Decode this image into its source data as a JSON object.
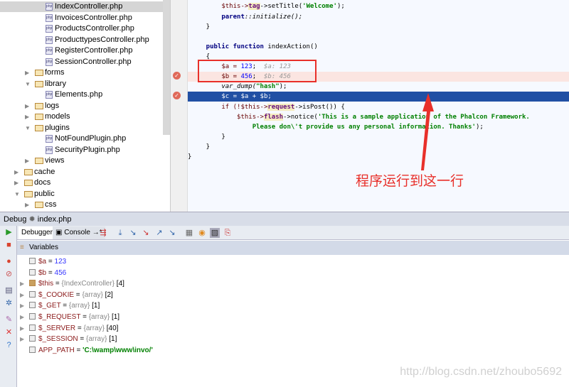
{
  "project_tree": {
    "items": [
      {
        "label": "IndexController.php",
        "type": "php",
        "level": 3,
        "selected": true
      },
      {
        "label": "InvoicesController.php",
        "type": "php",
        "level": 3
      },
      {
        "label": "ProductsController.php",
        "type": "php",
        "level": 3
      },
      {
        "label": "ProducttypesController.php",
        "type": "php",
        "level": 3
      },
      {
        "label": "RegisterController.php",
        "type": "php",
        "level": 3
      },
      {
        "label": "SessionController.php",
        "type": "php",
        "level": 3
      },
      {
        "label": "forms",
        "type": "folder",
        "level": 2,
        "expanded": false
      },
      {
        "label": "library",
        "type": "folder",
        "level": 2,
        "expanded": true
      },
      {
        "label": "Elements.php",
        "type": "php",
        "level": 3
      },
      {
        "label": "logs",
        "type": "folder",
        "level": 2,
        "expanded": false
      },
      {
        "label": "models",
        "type": "folder",
        "level": 2,
        "expanded": false
      },
      {
        "label": "plugins",
        "type": "folder",
        "level": 2,
        "expanded": true
      },
      {
        "label": "NotFoundPlugin.php",
        "type": "php",
        "level": 3
      },
      {
        "label": "SecurityPlugin.php",
        "type": "php",
        "level": 3
      },
      {
        "label": "views",
        "type": "folder",
        "level": 2,
        "expanded": false
      },
      {
        "label": "cache",
        "type": "folder",
        "level": 1,
        "expanded": false
      },
      {
        "label": "docs",
        "type": "folder",
        "level": 1,
        "expanded": false
      },
      {
        "label": "public",
        "type": "folder",
        "level": 1,
        "expanded": true
      },
      {
        "label": "css",
        "type": "folder",
        "level": 2,
        "expanded": false
      }
    ]
  },
  "editor": {
    "lines": {
      "l1a": "        $this->",
      "l1b": "tag",
      "l1c": "->setTitle(",
      "l1d": "'Welcome'",
      "l1e": ");",
      "l2a": "        parent",
      "l2b": "::initialize();",
      "l3": "    }",
      "l4a": "    public function ",
      "l4b": "indexAction()",
      "l5": "    {",
      "l6a": "        $a = ",
      "l6b": "123",
      ";": ";",
      "l6h": "  $a: 123",
      "l7a": "        $b = ",
      "l7b": "456",
      "l7h": "  $b: 456",
      "l8a": "        var_dump(",
      "l8b": "\"hash\"",
      "l8c": ");",
      "l9": "        $c = $a + $b;",
      "l10a": "        if (!$this->",
      "l10b": "request",
      "l10c": "->isPost()) {",
      "l11a": "            $this->",
      "l11b": "flash",
      "l11c": "->notice(",
      "l11d": "'This is a sample application of the Phalcon Framework.",
      "l12": "                Please don\\'t provide us any personal information. Thanks'",
      "l12e": ");",
      "l13": "        }",
      "l14": "    }",
      "l15": "}"
    }
  },
  "annotation": "程序运行到这一行",
  "debug": {
    "title": "Debug",
    "file": "index.php",
    "tabs": {
      "debugger": "Debugger",
      "console": "Console",
      "console_suffix": "→*"
    },
    "variables_header": "Variables",
    "variables": [
      {
        "name": "$a",
        "eq": " = ",
        "value": "123",
        "kind": "int"
      },
      {
        "name": "$b",
        "eq": " = ",
        "value": "456",
        "kind": "int"
      },
      {
        "name": "$this",
        "eq": " = ",
        "type": "{IndexController}",
        "count": " [4]",
        "kind": "object"
      },
      {
        "name": "$_COOKIE",
        "eq": " = ",
        "type": "{array}",
        "count": " [2]",
        "kind": "array"
      },
      {
        "name": "$_GET",
        "eq": " = ",
        "type": "{array}",
        "count": " [1]",
        "kind": "array"
      },
      {
        "name": "$_REQUEST",
        "eq": " = ",
        "type": "{array}",
        "count": " [1]",
        "kind": "array"
      },
      {
        "name": "$_SERVER",
        "eq": " = ",
        "type": "{array}",
        "count": " [40]",
        "kind": "array"
      },
      {
        "name": "$_SESSION",
        "eq": " = ",
        "type": "{array}",
        "count": " [1]",
        "kind": "array"
      },
      {
        "name": "APP_PATH",
        "eq": " = ",
        "value": "'C:\\wamp\\www\\invo/'",
        "kind": "string"
      }
    ]
  },
  "watermark": "http://blog.csdn.net/zhoubo5692",
  "colors": {
    "current_line": "#2150a4",
    "breakpoint_line": "#fbe5e1",
    "annotation": "#e8302a"
  }
}
